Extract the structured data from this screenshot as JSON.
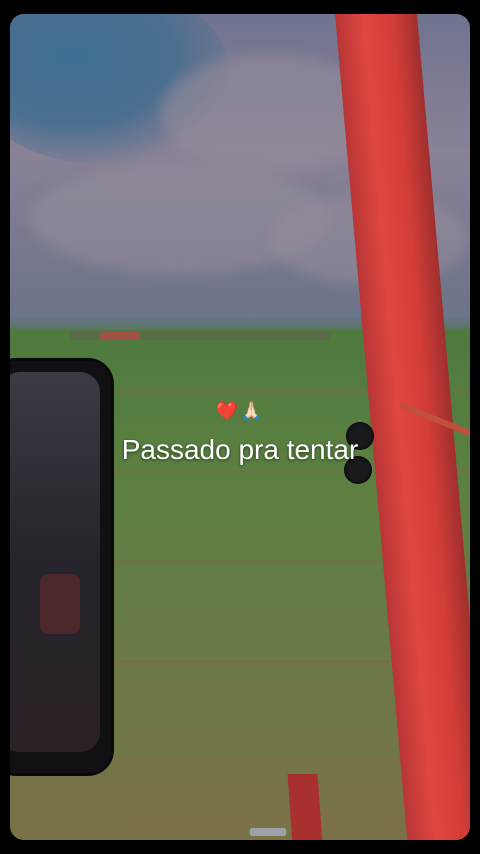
{
  "overlay": {
    "emoji": "❤️🙏🏻",
    "caption": "Passado pra tentar"
  },
  "scene": {
    "description_icons": [
      "heart-icon",
      "praying-hands-icon"
    ],
    "colors": {
      "sky": "#77798e",
      "sky_blue": "#3f6f93",
      "field_green": "#5c8041",
      "pillar_red": "#e0473f",
      "mirror": "#111114",
      "frame": "#000000"
    }
  }
}
